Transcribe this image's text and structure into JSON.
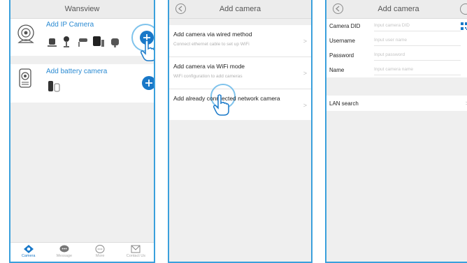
{
  "panel1": {
    "title": "Wansview",
    "ip_camera_title": "Add IP Camera",
    "battery_camera_title": "Add battery camera",
    "tabs": [
      {
        "label": "Camera",
        "icon": "camera-tab-icon",
        "active": true
      },
      {
        "label": "Message",
        "icon": "message-tab-icon",
        "active": false
      },
      {
        "label": "More",
        "icon": "more-tab-icon",
        "active": false
      },
      {
        "label": "Contact Us",
        "icon": "contact-tab-icon",
        "active": false
      }
    ]
  },
  "panel2": {
    "title": "Add camera",
    "items": [
      {
        "title": "Add camera via wired method",
        "subtitle": "Connect ethernet cable to set up WiFi"
      },
      {
        "title": "Add camera via WiFi mode",
        "subtitle": "WiFi configuration to add cameras"
      },
      {
        "title": "Add already connrected network camera",
        "subtitle": ""
      }
    ]
  },
  "panel3": {
    "title": "Add camera",
    "fields": [
      {
        "label": "Camera DID",
        "placeholder": "Input camera DID"
      },
      {
        "label": "Username",
        "placeholder": "Input user name"
      },
      {
        "label": "Password",
        "placeholder": "Input password"
      },
      {
        "label": "Name",
        "placeholder": "Input camera name"
      }
    ],
    "lan_search": "LAN search"
  },
  "colors": {
    "accent": "#1978c8",
    "frame": "#3aa0dc",
    "ring": "#7fc3ec"
  }
}
